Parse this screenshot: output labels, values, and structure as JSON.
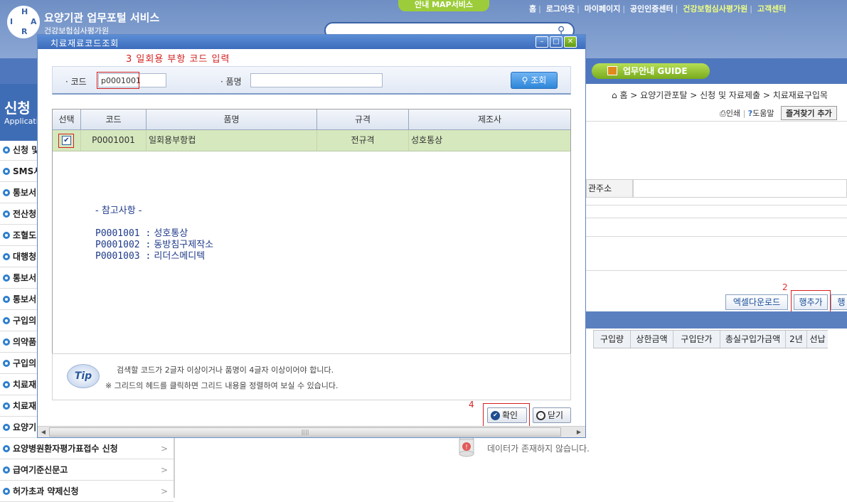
{
  "portal": {
    "logo_letters": [
      "H",
      "I",
      "R",
      "A"
    ],
    "title": "요양기관 업무포털 서비스",
    "subtitle": "건강보험심사평가원",
    "map_tab": "안내 MAP서비스",
    "topnav": [
      "홈",
      "로그아웃",
      "마이페이지",
      "공인인증센터",
      "건강보험심사평가원",
      "고객센터"
    ],
    "guide_button": "업무안내 GUIDE",
    "side_title": "신청",
    "side_title_en": "Applicati",
    "side_items": [
      "신청 및",
      "SMS서",
      "통보서",
      "전산청",
      "조혈도",
      "대행청",
      "통보서",
      "통보서",
      "구입의",
      "의약품",
      "구입의",
      "치료재",
      "치료재",
      "요양기",
      "요양병원환자평가표접수 신청",
      "급여기준신문고",
      "허가초과 약제신청"
    ],
    "breadcrumb": "홈 > 요양기관포탈 > 신청 및 자료제출 > 치료재료구입목",
    "print_label": "인쇄",
    "help_label": "도움말",
    "favorite_label": "즐겨찾기 추가",
    "address_label": "관주소",
    "step2": "2",
    "excel_button": "엑셀다운로드",
    "add_row_button": "행추가",
    "partial_button": "행",
    "columns": [
      "구입량",
      "상한금액",
      "구입단가",
      "총실구입가금액",
      "2년",
      "선납"
    ],
    "no_data": "데이터가 존재하지 않습니다."
  },
  "dialog": {
    "title": "치료재료코드조회",
    "step3": "3  일회용 부항 코드 입력",
    "code_label": "· 코드",
    "code_value": "p0001001",
    "name_label": "· 품명",
    "name_value": "",
    "query_button": "조회",
    "grid_headers": [
      "선택",
      "코드",
      "품명",
      "규격",
      "제조사"
    ],
    "rows": [
      {
        "checked": true,
        "code": "P0001001",
        "name": "일회용부항컵",
        "spec": "전규격",
        "maker": "성호통상"
      }
    ],
    "notes_title": "- 참고사항 -",
    "notes": [
      {
        "code": "P0001001 :",
        "maker": "성호통상"
      },
      {
        "code": "P0001002 :",
        "maker": "동방침구제작소"
      },
      {
        "code": "P0001003 :",
        "maker": "리더스메디텍"
      }
    ],
    "tip_label": "Tip",
    "tip_line1": "검색할 코드가 2글자 이상이거나 품명이 4글자 이상이어야 합니다.",
    "tip_line2": "※ 그리드의 헤드를 클릭하면 그리드 내용을 정렬하여 보실 수 있습니다.",
    "step4": "4",
    "confirm_button": "확인",
    "close_button": "닫기"
  }
}
